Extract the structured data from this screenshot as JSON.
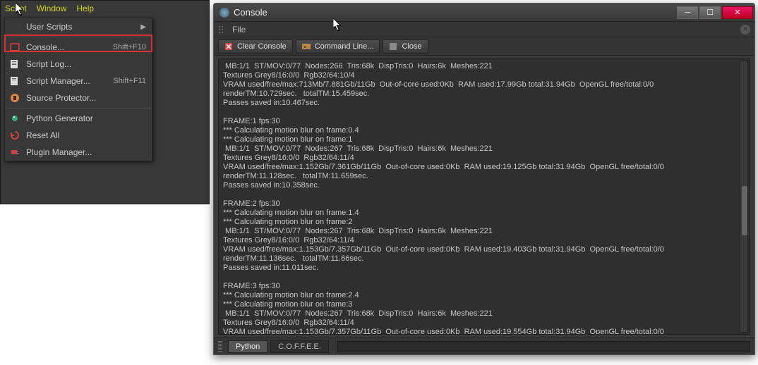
{
  "menubar": {
    "script": "Script",
    "window": "Window",
    "help": "Help"
  },
  "menu": {
    "user_scripts": "User Scripts",
    "console": "Console...",
    "console_shortcut": "Shift+F10",
    "script_log": "Script Log...",
    "script_manager": "Script Manager...",
    "script_manager_shortcut": "Shift+F11",
    "source_protector": "Source Protector...",
    "python_generator": "Python Generator",
    "reset_all": "Reset All",
    "plugin_manager": "Plugin Manager..."
  },
  "console": {
    "title": "Console",
    "file": "File",
    "clear": "Clear Console",
    "cmdline": "Command Line...",
    "close": "Close",
    "tab_python": "Python",
    "tab_coffee": "C.O.F.F.E.E.",
    "log": " MB:1/1  ST/MOV:0/77  Nodes:266  Tris:68k  DispTris:0  Hairs:6k  Meshes:221\nTextures Grey8/16:0/0  Rgb32/64:10/4\nVRAM used/free/max:713Mb/7.881Gb/11Gb  Out-of-core used:0Kb  RAM used:17.99Gb total:31.94Gb  OpenGL free/total:0/0\nrenderTM:10.729sec.   totalTM:15.459sec.\nPasses saved in:10.467sec.\n\nFRAME:1 fps:30\n*** Calculating motion blur on frame:0.4\n*** Calculating motion blur on frame:1\n MB:1/1  ST/MOV:0/77  Nodes:267  Tris:68k  DispTris:0  Hairs:6k  Meshes:221\nTextures Grey8/16:0/0  Rgb32/64:11/4\nVRAM used/free/max:1.152Gb/7.361Gb/11Gb  Out-of-core used:0Kb  RAM used:19.125Gb total:31.94Gb  OpenGL free/total:0/0\nrenderTM:11.128sec.   totalTM:11.659sec.\nPasses saved in:10.358sec.\n\nFRAME:2 fps:30\n*** Calculating motion blur on frame:1.4\n*** Calculating motion blur on frame:2\n MB:1/1  ST/MOV:0/77  Nodes:267  Tris:68k  DispTris:0  Hairs:6k  Meshes:221\nTextures Grey8/16:0/0  Rgb32/64:11/4\nVRAM used/free/max:1.153Gb/7.357Gb/11Gb  Out-of-core used:0Kb  RAM used:19.403Gb total:31.94Gb  OpenGL free/total:0/0\nrenderTM:11.136sec.   totalTM:11.66sec.\nPasses saved in:11.011sec.\n\nFRAME:3 fps:30\n*** Calculating motion blur on frame:2.4\n*** Calculating motion blur on frame:3\n MB:1/1  ST/MOV:0/77  Nodes:267  Tris:68k  DispTris:0  Hairs:6k  Meshes:221\nTextures Grey8/16:0/0  Rgb32/64:11/4\nVRAM used/free/max:1.153Gb/7.357Gb/11Gb  Out-of-core used:0Kb  RAM used:19.554Gb total:31.94Gb  OpenGL free/total:0/0"
  }
}
